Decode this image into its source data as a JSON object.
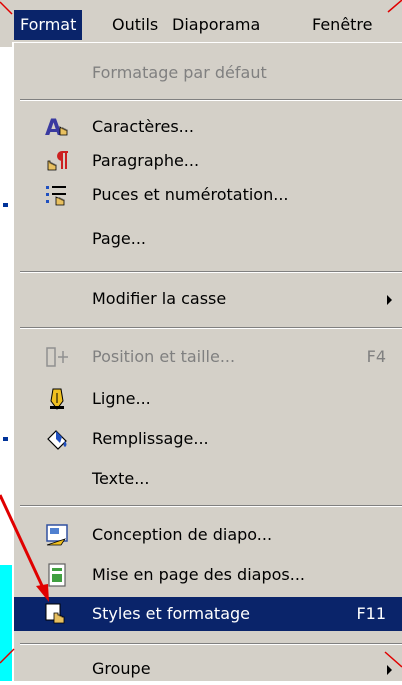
{
  "menubar": {
    "items": [
      {
        "label": "Format",
        "active": true
      },
      {
        "label": "Outils",
        "active": false
      },
      {
        "label": "Diaporama",
        "active": false
      },
      {
        "label": "Fenêtre",
        "active": false
      }
    ]
  },
  "menu": {
    "default_format": "Formatage par défaut",
    "characters": "Caractères...",
    "paragraph": "Paragraphe...",
    "bullets": "Puces et numérotation...",
    "page": "Page...",
    "change_case": "Modifier la casse",
    "position_size": "Position et taille...",
    "position_size_shortcut": "F4",
    "line": "Ligne...",
    "fill": "Remplissage...",
    "text": "Texte...",
    "slide_design": "Conception de diapo...",
    "slide_layout": "Mise en page des diapos...",
    "styles": "Styles et formatage",
    "styles_shortcut": "F11",
    "group": "Groupe"
  },
  "colors": {
    "menu_bg": "#d4d0c8",
    "highlight": "#0a246a",
    "disabled": "#808080",
    "annotation": "#e00000"
  }
}
